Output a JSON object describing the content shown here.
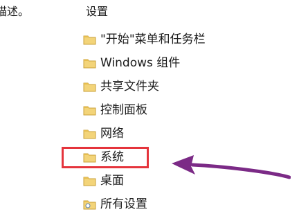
{
  "left_text": "描述。",
  "tree": {
    "heading": "设置",
    "items": [
      {
        "label": "\"开始\"菜单和任务栏",
        "icon": "folder-icon"
      },
      {
        "label": "Windows 组件",
        "icon": "folder-icon"
      },
      {
        "label": "共享文件夹",
        "icon": "folder-icon"
      },
      {
        "label": "控制面板",
        "icon": "folder-icon"
      },
      {
        "label": "网络",
        "icon": "folder-icon"
      },
      {
        "label": "系统",
        "icon": "folder-icon"
      },
      {
        "label": "桌面",
        "icon": "folder-icon"
      },
      {
        "label": "所有设置",
        "icon": "settings-folder-icon"
      }
    ]
  },
  "annotation": {
    "highlight_color": "#e5343c",
    "arrow_color": "#7b2a86"
  },
  "colors": {
    "folder_body": "#f3d479",
    "folder_tab": "#e6bd4f",
    "folder_outline": "#caa039"
  }
}
